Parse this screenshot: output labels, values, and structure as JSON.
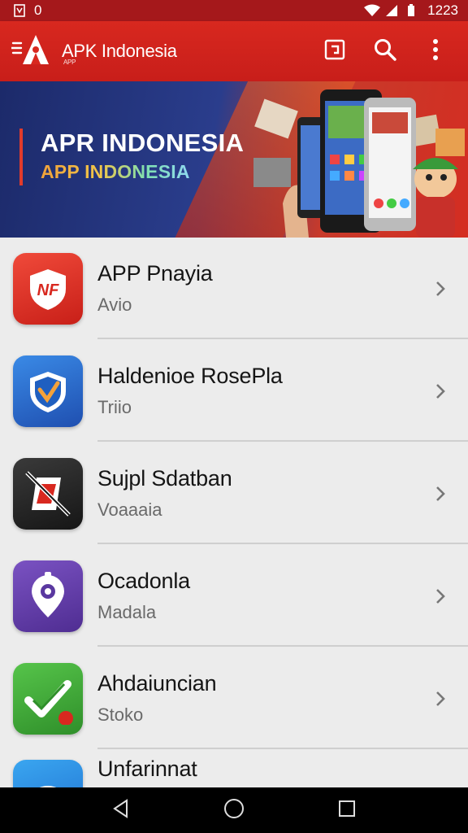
{
  "status_bar": {
    "left_text": "0",
    "time": "1223"
  },
  "app_bar": {
    "title": "APK Indonesia",
    "logo_subtext": "APP",
    "actions": [
      {
        "icon": "square-frame-icon"
      },
      {
        "icon": "search-icon"
      },
      {
        "icon": "more-vert-icon"
      }
    ]
  },
  "banner": {
    "title": "APR INDONESIA",
    "subtitle": "APP INDONESIA"
  },
  "apps": [
    {
      "name": "APP Pnayia",
      "subtitle": "Avio",
      "icon": "shield-nf-icon",
      "icon_color": "#e53a2d",
      "icon_text": "NF"
    },
    {
      "name": "Haldenioe RosePla",
      "subtitle": "Triio",
      "icon": "shield-check-icon",
      "icon_color": "#2a6fd6"
    },
    {
      "name": "Sujpl Sdatban",
      "subtitle": "Voaaaia",
      "icon": "blocked-icon",
      "icon_color": "#2b2b2b"
    },
    {
      "name": "Ocadonla",
      "subtitle": "Madala",
      "icon": "location-pin-icon",
      "icon_color": "#6a3fae"
    },
    {
      "name": "Ahdaiuncian",
      "subtitle": "Stoko",
      "icon": "check-icon",
      "icon_color": "#3fae3a"
    },
    {
      "name": "Unfarinnat",
      "subtitle": "",
      "icon": "cloud-icon",
      "icon_color": "#2a8fe6"
    }
  ],
  "colors": {
    "primary": "#d8281f",
    "status_bar": "#a5181b",
    "background": "#ececec"
  }
}
